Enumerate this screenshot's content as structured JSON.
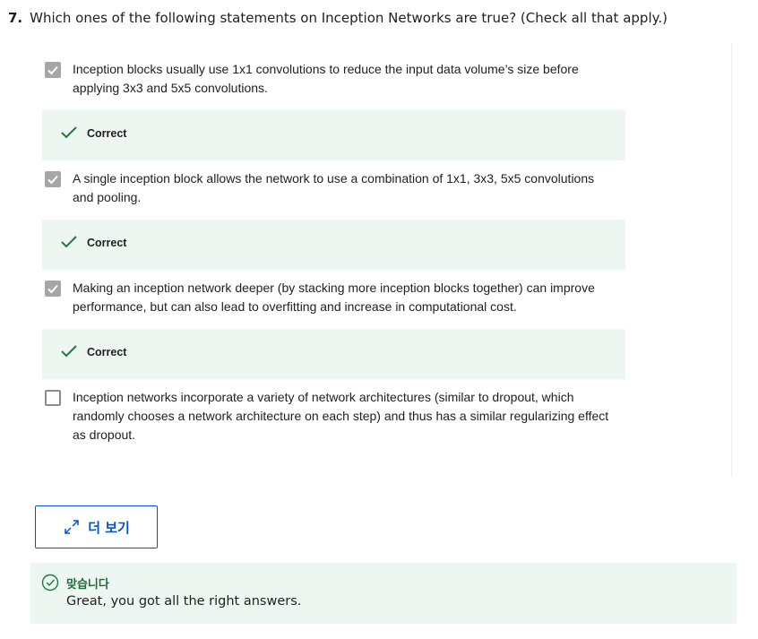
{
  "question": {
    "number": "7.",
    "text": "Which ones of the following statements on Inception Networks are true? (Check all that apply.)"
  },
  "options": [
    {
      "text": "Inception blocks usually use 1x1 convolutions to reduce the input data volume’s size before applying 3x3 and 5x5 convolutions.",
      "checked": true,
      "feedback": "Correct"
    },
    {
      "text": "A single inception block allows the network to use a combination of 1x1, 3x3, 5x5 convolutions and pooling.",
      "checked": true,
      "feedback": "Correct"
    },
    {
      "text": "Making an inception network deeper (by stacking more inception blocks together) can improve performance, but can also lead to overfitting and increase in computational cost.",
      "checked": true,
      "feedback": "Correct"
    },
    {
      "text": "Inception networks incorporate a variety of network architectures (similar to dropout, which randomly chooses a network architecture on each step) and thus has a similar regularizing effect as dropout.",
      "checked": false
    }
  ],
  "more_button": {
    "label": "더 보기",
    "icon": "expand-icon"
  },
  "result": {
    "title": "맞습니다",
    "message": "Great, you got all the right answers.",
    "icon": "check-circle-icon"
  },
  "colors": {
    "accent": "#0056d2",
    "success": "#1e6b3c",
    "feedback_bg": "#eef6f1",
    "checkbox_checked": "#a6a6a6"
  }
}
